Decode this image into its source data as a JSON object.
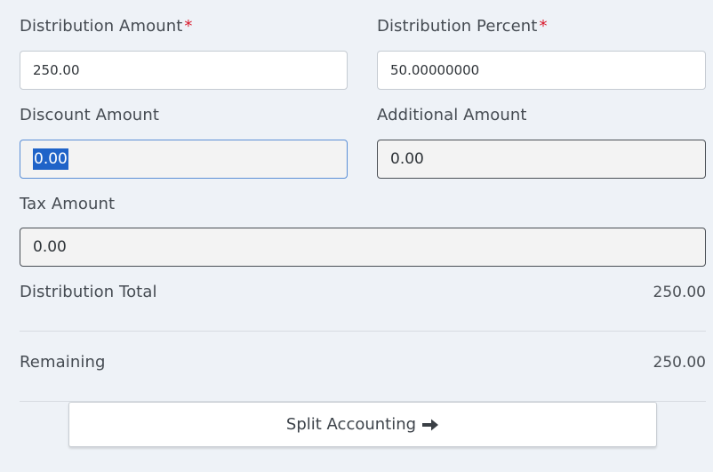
{
  "form": {
    "distribution_amount": {
      "label": "Distribution Amount",
      "required_marker": "*",
      "value": "250.00"
    },
    "distribution_percent": {
      "label": "Distribution Percent",
      "required_marker": "*",
      "value": "50.00000000"
    },
    "discount_amount": {
      "label": "Discount Amount",
      "value": "0.00",
      "text_selected": true
    },
    "additional_amount": {
      "label": "Additional Amount",
      "value": "0.00"
    },
    "tax_amount": {
      "label": "Tax Amount",
      "value": "0.00"
    }
  },
  "summary": {
    "distribution_total": {
      "label": "Distribution Total",
      "value": "250.00"
    },
    "remaining": {
      "label": "Remaining",
      "value": "250.00"
    }
  },
  "actions": {
    "split_accounting_label": "Split Accounting",
    "split_accounting_icon": "arrow-right-icon"
  },
  "colors": {
    "background": "#eef2f7",
    "required": "#d9182b",
    "selection": "#1f63c8",
    "focus_border": "#5b8fd6"
  }
}
